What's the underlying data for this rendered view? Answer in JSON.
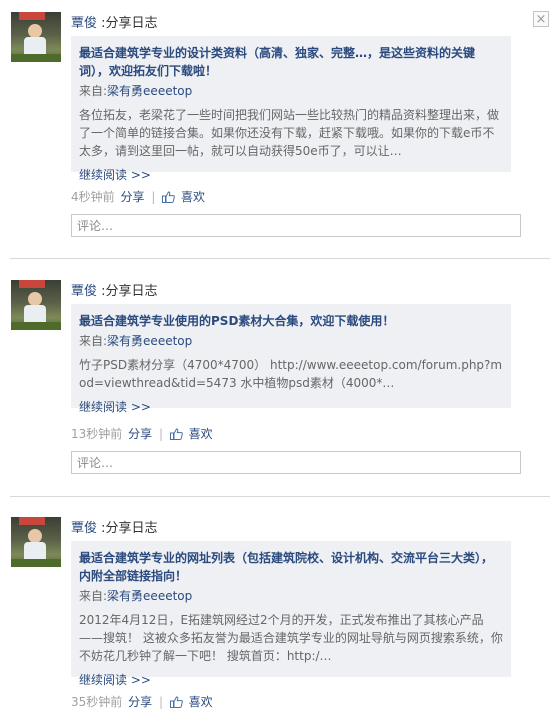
{
  "close_icon": "×",
  "posts": [
    {
      "author": "覃俊",
      "action": ":分享日志",
      "title": "最适合建筑学专业的设计类资料（高清、独家、完整…，是这些资料的关键词），欢迎拓友们下载啦！",
      "source_prefix": "来自:",
      "source_name": "梁有勇eeeetop",
      "excerpt": "各位拓友，老梁花了一些时间把我们网站一些比较热门的精品资料整理出来，做了一个简单的链接合集。如果你还没有下载，赶紧下载哦。如果你的下载e币不太多，请到这里回一帖，就可以自动获得50e币了，可以让…",
      "more": "继续阅读 >>",
      "time": "4秒钟前",
      "share": "分享",
      "like": "喜欢",
      "comment_placeholder": "评论…"
    },
    {
      "author": "覃俊",
      "action": ":分享日志",
      "title": "最适合建筑学专业使用的PSD素材大合集，欢迎下载使用！",
      "source_prefix": "来自:",
      "source_name": "梁有勇eeeetop",
      "excerpt": "竹子PSD素材分享（4700*4700） http://www.eeeetop.com/forum.php?mod=viewthread&tid=5473 水中植物psd素材（4000*…",
      "more": "继续阅读 >>",
      "time": "13秒钟前",
      "share": "分享",
      "like": "喜欢",
      "comment_placeholder": "评论…"
    },
    {
      "author": "覃俊",
      "action": ":分享日志",
      "title": "最适合建筑学专业的网址列表（包括建筑院校、设计机构、交流平台三大类），内附全部链接指向！",
      "source_prefix": "来自:",
      "source_name": "梁有勇eeeetop",
      "excerpt": "2012年4月12日，E拓建筑网经过2个月的开发，正式发布推出了其核心产品——搜筑！ 这被众多拓友誉为最适合建筑学专业的网址导航与网页搜索系统，你不妨花几秒钟了解一下吧！ 搜筑首页：http:/…",
      "more": "继续阅读 >>",
      "time": "35秒钟前",
      "share": "分享",
      "like": "喜欢"
    }
  ]
}
